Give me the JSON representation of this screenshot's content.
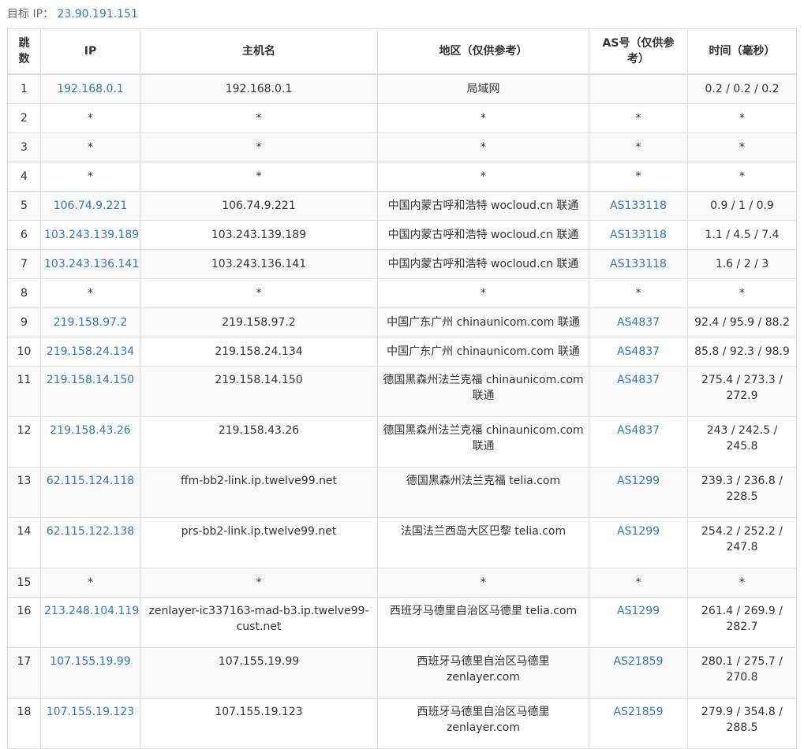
{
  "target": {
    "label": "目标 IP：",
    "ip": "23.90.191.151"
  },
  "headers": {
    "hop": "跳数",
    "ip": "IP",
    "host": "主机名",
    "region": "地区（仅供参考）",
    "as": "AS号（仅供参考）",
    "time": "时间（毫秒）"
  },
  "rows": [
    {
      "hop": "1",
      "ip": "192.168.0.1",
      "host": "192.168.0.1",
      "region": "局域网",
      "as": "",
      "time": "0.2 / 0.2 / 0.2"
    },
    {
      "hop": "2",
      "ip": "*",
      "host": "*",
      "region": "*",
      "as": "*",
      "time": "*"
    },
    {
      "hop": "3",
      "ip": "*",
      "host": "*",
      "region": "*",
      "as": "*",
      "time": "*"
    },
    {
      "hop": "4",
      "ip": "*",
      "host": "*",
      "region": "*",
      "as": "*",
      "time": "*"
    },
    {
      "hop": "5",
      "ip": "106.74.9.221",
      "host": "106.74.9.221",
      "region": "中国内蒙古呼和浩特 wocloud.cn 联通",
      "as": "AS133118",
      "time": "0.9 / 1 / 0.9"
    },
    {
      "hop": "6",
      "ip": "103.243.139.189",
      "host": "103.243.139.189",
      "region": "中国内蒙古呼和浩特 wocloud.cn 联通",
      "as": "AS133118",
      "time": "1.1 / 4.5 / 7.4"
    },
    {
      "hop": "7",
      "ip": "103.243.136.141",
      "host": "103.243.136.141",
      "region": "中国内蒙古呼和浩特 wocloud.cn 联通",
      "as": "AS133118",
      "time": "1.6 / 2 / 3"
    },
    {
      "hop": "8",
      "ip": "*",
      "host": "*",
      "region": "*",
      "as": "*",
      "time": "*"
    },
    {
      "hop": "9",
      "ip": "219.158.97.2",
      "host": "219.158.97.2",
      "region": "中国广东广州 chinaunicom.com 联通",
      "as": "AS4837",
      "time": "92.4 / 95.9 / 88.2"
    },
    {
      "hop": "10",
      "ip": "219.158.24.134",
      "host": "219.158.24.134",
      "region": "中国广东广州 chinaunicom.com 联通",
      "as": "AS4837",
      "time": "85.8 / 92.3 / 98.9"
    },
    {
      "hop": "11",
      "ip": "219.158.14.150",
      "host": "219.158.14.150",
      "region": "德国黑森州法兰克福 chinaunicom.com 联通",
      "as": "AS4837",
      "time": "275.4 / 273.3 / 272.9"
    },
    {
      "hop": "12",
      "ip": "219.158.43.26",
      "host": "219.158.43.26",
      "region": "德国黑森州法兰克福 chinaunicom.com 联通",
      "as": "AS4837",
      "time": "243 / 242.5 / 245.8"
    },
    {
      "hop": "13",
      "ip": "62.115.124.118",
      "host": "ffm-bb2-link.ip.twelve99.net",
      "region": "德国黑森州法兰克福 telia.com",
      "as": "AS1299",
      "time": "239.3 / 236.8 / 228.5"
    },
    {
      "hop": "14",
      "ip": "62.115.122.138",
      "host": "prs-bb2-link.ip.twelve99.net",
      "region": "法国法兰西岛大区巴黎 telia.com",
      "as": "AS1299",
      "time": "254.2 / 252.2 / 247.8"
    },
    {
      "hop": "15",
      "ip": "*",
      "host": "*",
      "region": "*",
      "as": "*",
      "time": "*"
    },
    {
      "hop": "16",
      "ip": "213.248.104.119",
      "host": "zenlayer-ic337163-mad-b3.ip.twelve99-cust.net",
      "region": "西班牙马德里自治区马德里 telia.com",
      "as": "AS1299",
      "time": "261.4 / 269.9 / 282.7"
    },
    {
      "hop": "17",
      "ip": "107.155.19.99",
      "host": "107.155.19.99",
      "region": "西班牙马德里自治区马德里 zenlayer.com",
      "as": "AS21859",
      "time": "280.1 / 275.7 / 270.8"
    },
    {
      "hop": "18",
      "ip": "107.155.19.123",
      "host": "107.155.19.123",
      "region": "西班牙马德里自治区马德里 zenlayer.com",
      "as": "AS21859",
      "time": "279.9 / 354.8 / 288.5"
    }
  ]
}
